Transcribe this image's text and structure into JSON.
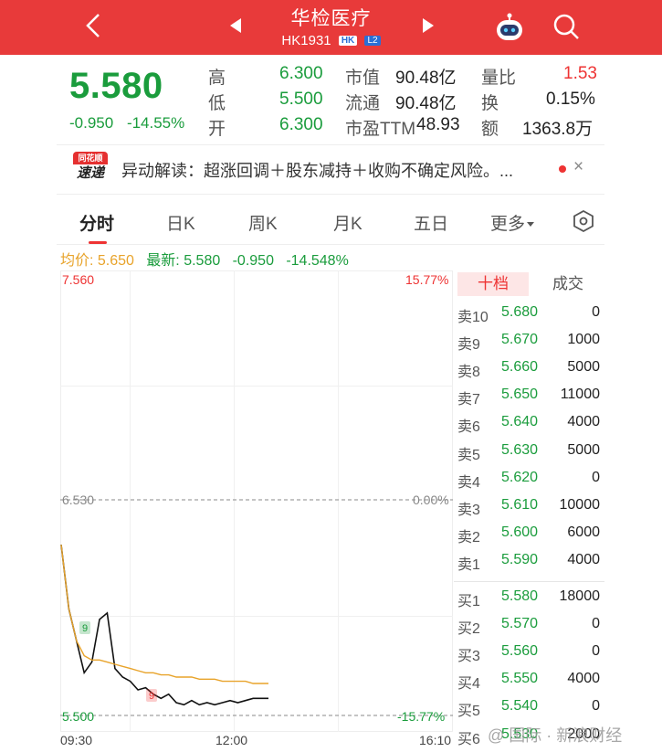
{
  "header": {
    "title": "华检医疗",
    "code": "HK1931",
    "tag_market": "HK",
    "tag_level": "L2"
  },
  "quote": {
    "price": "5.580",
    "change": "-0.950",
    "change_pct": "-14.55%",
    "high_label": "高",
    "high": "6.300",
    "low_label": "低",
    "low": "5.500",
    "open_label": "开",
    "open": "6.300",
    "mktcap_label": "市值",
    "mktcap": "90.48亿",
    "float_label": "流通",
    "float": "90.48亿",
    "pe_label": "市盈TTM",
    "pe": "48.93",
    "volratio_label": "量比",
    "volratio": "1.53",
    "turnover_label": "换",
    "turnover": "0.15%",
    "amount_label": "额",
    "amount": "1363.8万"
  },
  "news": {
    "logo_top": "同花顺",
    "logo_bottom": "速递",
    "text": "异动解读：超涨回调＋股东减持＋收购不确定风险。...",
    "close": "×"
  },
  "tabs": [
    "分时",
    "日K",
    "周K",
    "月K",
    "五日",
    "更多"
  ],
  "info_line": {
    "avg_label": "均价:",
    "avg": "5.650",
    "latest_label": "最新:",
    "latest": "5.580",
    "chg": "-0.950",
    "chg_pct": "-14.548%"
  },
  "chart_data": {
    "type": "line",
    "y_top": "7.560",
    "y_mid": "6.530",
    "y_bottom": "5.500",
    "pct_top": "15.77%",
    "pct_mid": "0.00%",
    "pct_bottom": "-15.77%",
    "ylim": [
      5.5,
      7.56
    ],
    "x_ticks": [
      "09:30",
      "12:00",
      "16:10"
    ],
    "markers": [
      "9",
      "9"
    ],
    "series": [
      {
        "name": "price",
        "color": "#111111",
        "values": [
          6.3,
          6.0,
          5.85,
          5.7,
          5.75,
          5.95,
          5.98,
          5.72,
          5.68,
          5.66,
          5.62,
          5.63,
          5.6,
          5.58,
          5.6,
          5.56,
          5.55,
          5.57,
          5.55,
          5.56,
          5.55,
          5.56,
          5.57,
          5.56,
          5.57,
          5.58,
          5.58,
          5.58
        ]
      },
      {
        "name": "avg",
        "color": "#e8a32a",
        "values": [
          6.3,
          6.0,
          5.85,
          5.78,
          5.76,
          5.76,
          5.75,
          5.74,
          5.73,
          5.72,
          5.71,
          5.7,
          5.7,
          5.69,
          5.69,
          5.68,
          5.68,
          5.68,
          5.67,
          5.67,
          5.67,
          5.66,
          5.66,
          5.66,
          5.66,
          5.65,
          5.65,
          5.65
        ]
      }
    ]
  },
  "orderbook": {
    "tab_active": "十档",
    "tab_other": "成交",
    "asks": [
      {
        "label": "卖10",
        "price": "5.680",
        "vol": "0"
      },
      {
        "label": "卖9",
        "price": "5.670",
        "vol": "1000"
      },
      {
        "label": "卖8",
        "price": "5.660",
        "vol": "5000"
      },
      {
        "label": "卖7",
        "price": "5.650",
        "vol": "11000"
      },
      {
        "label": "卖6",
        "price": "5.640",
        "vol": "4000"
      },
      {
        "label": "卖5",
        "price": "5.630",
        "vol": "5000"
      },
      {
        "label": "卖4",
        "price": "5.620",
        "vol": "0"
      },
      {
        "label": "卖3",
        "price": "5.610",
        "vol": "10000"
      },
      {
        "label": "卖2",
        "price": "5.600",
        "vol": "6000"
      },
      {
        "label": "卖1",
        "price": "5.590",
        "vol": "4000"
      }
    ],
    "bids": [
      {
        "label": "买1",
        "price": "5.580",
        "vol": "18000"
      },
      {
        "label": "买2",
        "price": "5.570",
        "vol": "0"
      },
      {
        "label": "买3",
        "price": "5.560",
        "vol": "0"
      },
      {
        "label": "买4",
        "price": "5.550",
        "vol": "4000"
      },
      {
        "label": "买5",
        "price": "5.540",
        "vol": "0"
      },
      {
        "label": "买6",
        "price": "5.530",
        "vol": "2000"
      }
    ]
  },
  "watermark": "@ 国际 · 新浪财经",
  "colors": {
    "header_red": "#e83a3a",
    "down_green": "#1a9c3c",
    "up_red": "#ee3333",
    "avg_orange": "#e8a32a"
  }
}
